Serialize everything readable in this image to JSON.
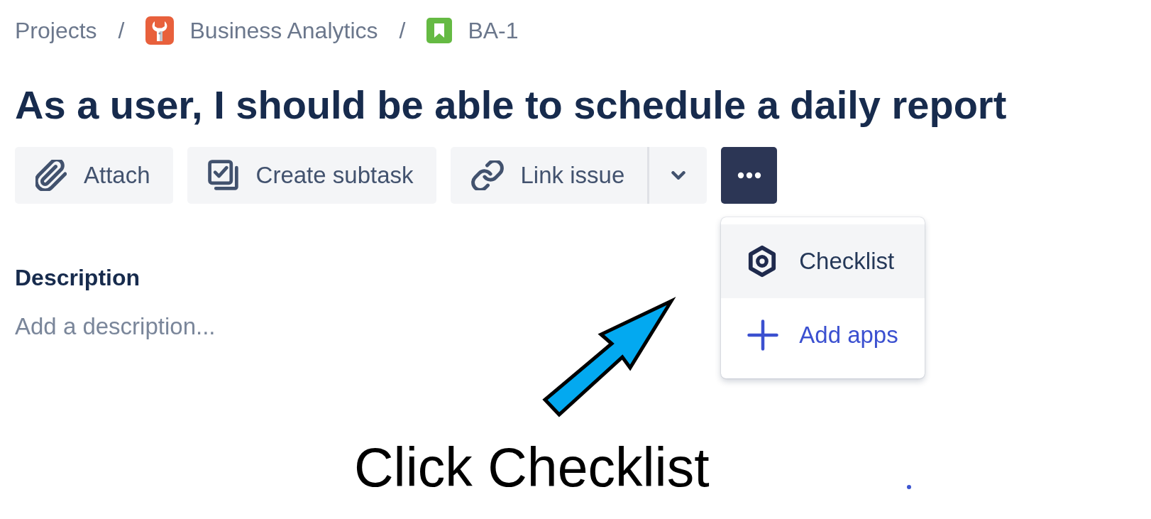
{
  "breadcrumbs": [
    {
      "label": "Projects",
      "kind": "root"
    },
    {
      "label": "Business Analytics",
      "kind": "project",
      "separator": "/"
    },
    {
      "label": "BA-1",
      "kind": "issue",
      "separator": "/"
    }
  ],
  "issue": {
    "title": "As a user, I should be able to schedule a daily report"
  },
  "toolbar": [
    {
      "label": "Attach",
      "kind": "attach"
    },
    {
      "label": "Create subtask",
      "kind": "subtask"
    },
    {
      "label": "Link issue",
      "kind": "link",
      "has_dropdown": true
    }
  ],
  "more_button": {
    "expanded": true
  },
  "menu": {
    "items": [
      {
        "label": "Checklist",
        "kind": "app",
        "highlighted": true
      },
      {
        "label": "Add apps",
        "kind": "action",
        "highlighted": false
      }
    ]
  },
  "description": {
    "heading": "Description",
    "placeholder": "Add a description..."
  },
  "annotation": {
    "text": "Click Checklist"
  }
}
